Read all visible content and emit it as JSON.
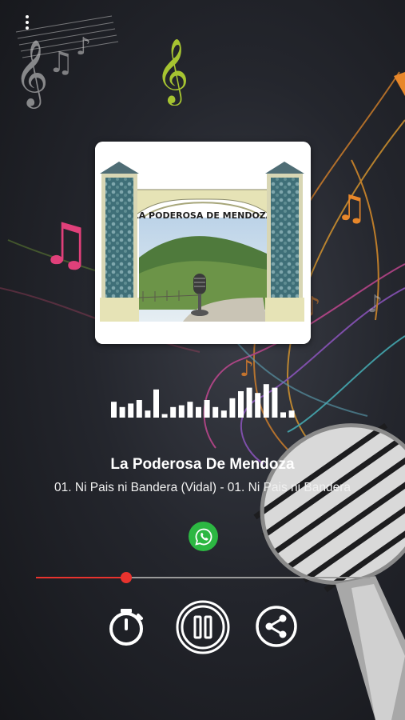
{
  "station": {
    "name": "La Poderosa De Mendoza"
  },
  "now_playing": {
    "title": "01. Ni Pais ni Bandera (Vidal)  -  01. Ni Pais ni Bandera"
  },
  "artwork": {
    "arch_text": "LA PODEROSA DE MENDOZA"
  },
  "player": {
    "progress": 0.27,
    "state": "playing"
  },
  "visualizer": {
    "levels": [
      0.45,
      0.3,
      0.4,
      0.5,
      0.2,
      0.8,
      0.1,
      0.3,
      0.35,
      0.45,
      0.3,
      0.5,
      0.3,
      0.2,
      0.55,
      0.75,
      0.85,
      0.7,
      0.95,
      0.85,
      0.15,
      0.2
    ]
  },
  "icons": {
    "menu": "more-vertical-icon",
    "whatsapp": "whatsapp-icon",
    "timer": "stopwatch-icon",
    "playpause": "pause-icon",
    "share": "share-icon"
  },
  "colors": {
    "accent": "#e8332e",
    "whatsapp": "#2cb742",
    "background": "#24262d"
  }
}
